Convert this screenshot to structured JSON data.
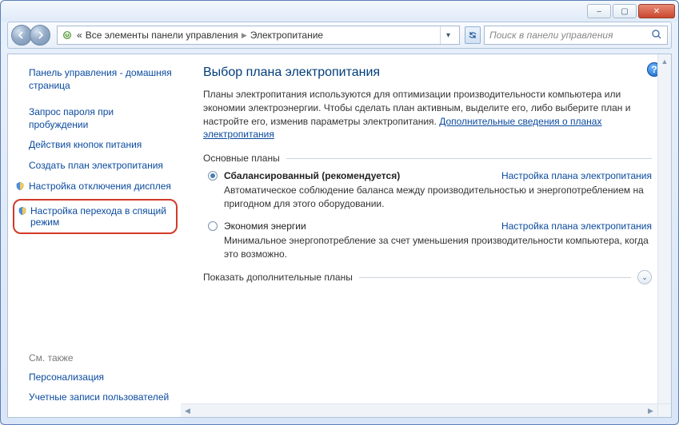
{
  "titlebar": {
    "min": "–",
    "max": "▢",
    "close": "✕"
  },
  "toolbar": {
    "breadcrumb_prefix": "«",
    "breadcrumb1": "Все элементы панели управления",
    "breadcrumb2": "Электропитание",
    "search_placeholder": "Поиск в панели управления"
  },
  "sidebar": {
    "home": "Панель управления - домашняя страница",
    "wake_password": "Запрос пароля при пробуждении",
    "button_actions": "Действия кнопок питания",
    "create_plan": "Создать план электропитания",
    "display_off": "Настройка отключения дисплея",
    "sleep": "Настройка перехода в спящий режим",
    "see_also": "См. также",
    "personalization": "Персонализация",
    "user_accounts": "Учетные записи пользователей"
  },
  "main": {
    "title": "Выбор плана электропитания",
    "desc_text": "Планы электропитания используются для оптимизации производительности компьютера или экономии электроэнергии. Чтобы сделать план активным, выделите его, либо выберите план и настройте его, изменив параметры электропитания. ",
    "desc_link": "Дополнительные сведения о планах электропитания",
    "section_main": "Основные планы",
    "plans": [
      {
        "name": "Сбалансированный (рекомендуется)",
        "link": "Настройка плана электропитания",
        "desc": "Автоматическое соблюдение баланса между производительностью и энергопотреблением на пригодном для этого оборудовании.",
        "checked": true
      },
      {
        "name": "Экономия энергии",
        "link": "Настройка плана электропитания",
        "desc": "Минимальное энергопотребление за счет уменьшения производительности компьютера, когда это возможно.",
        "checked": false
      }
    ],
    "expand_label": "Показать дополнительные планы"
  }
}
